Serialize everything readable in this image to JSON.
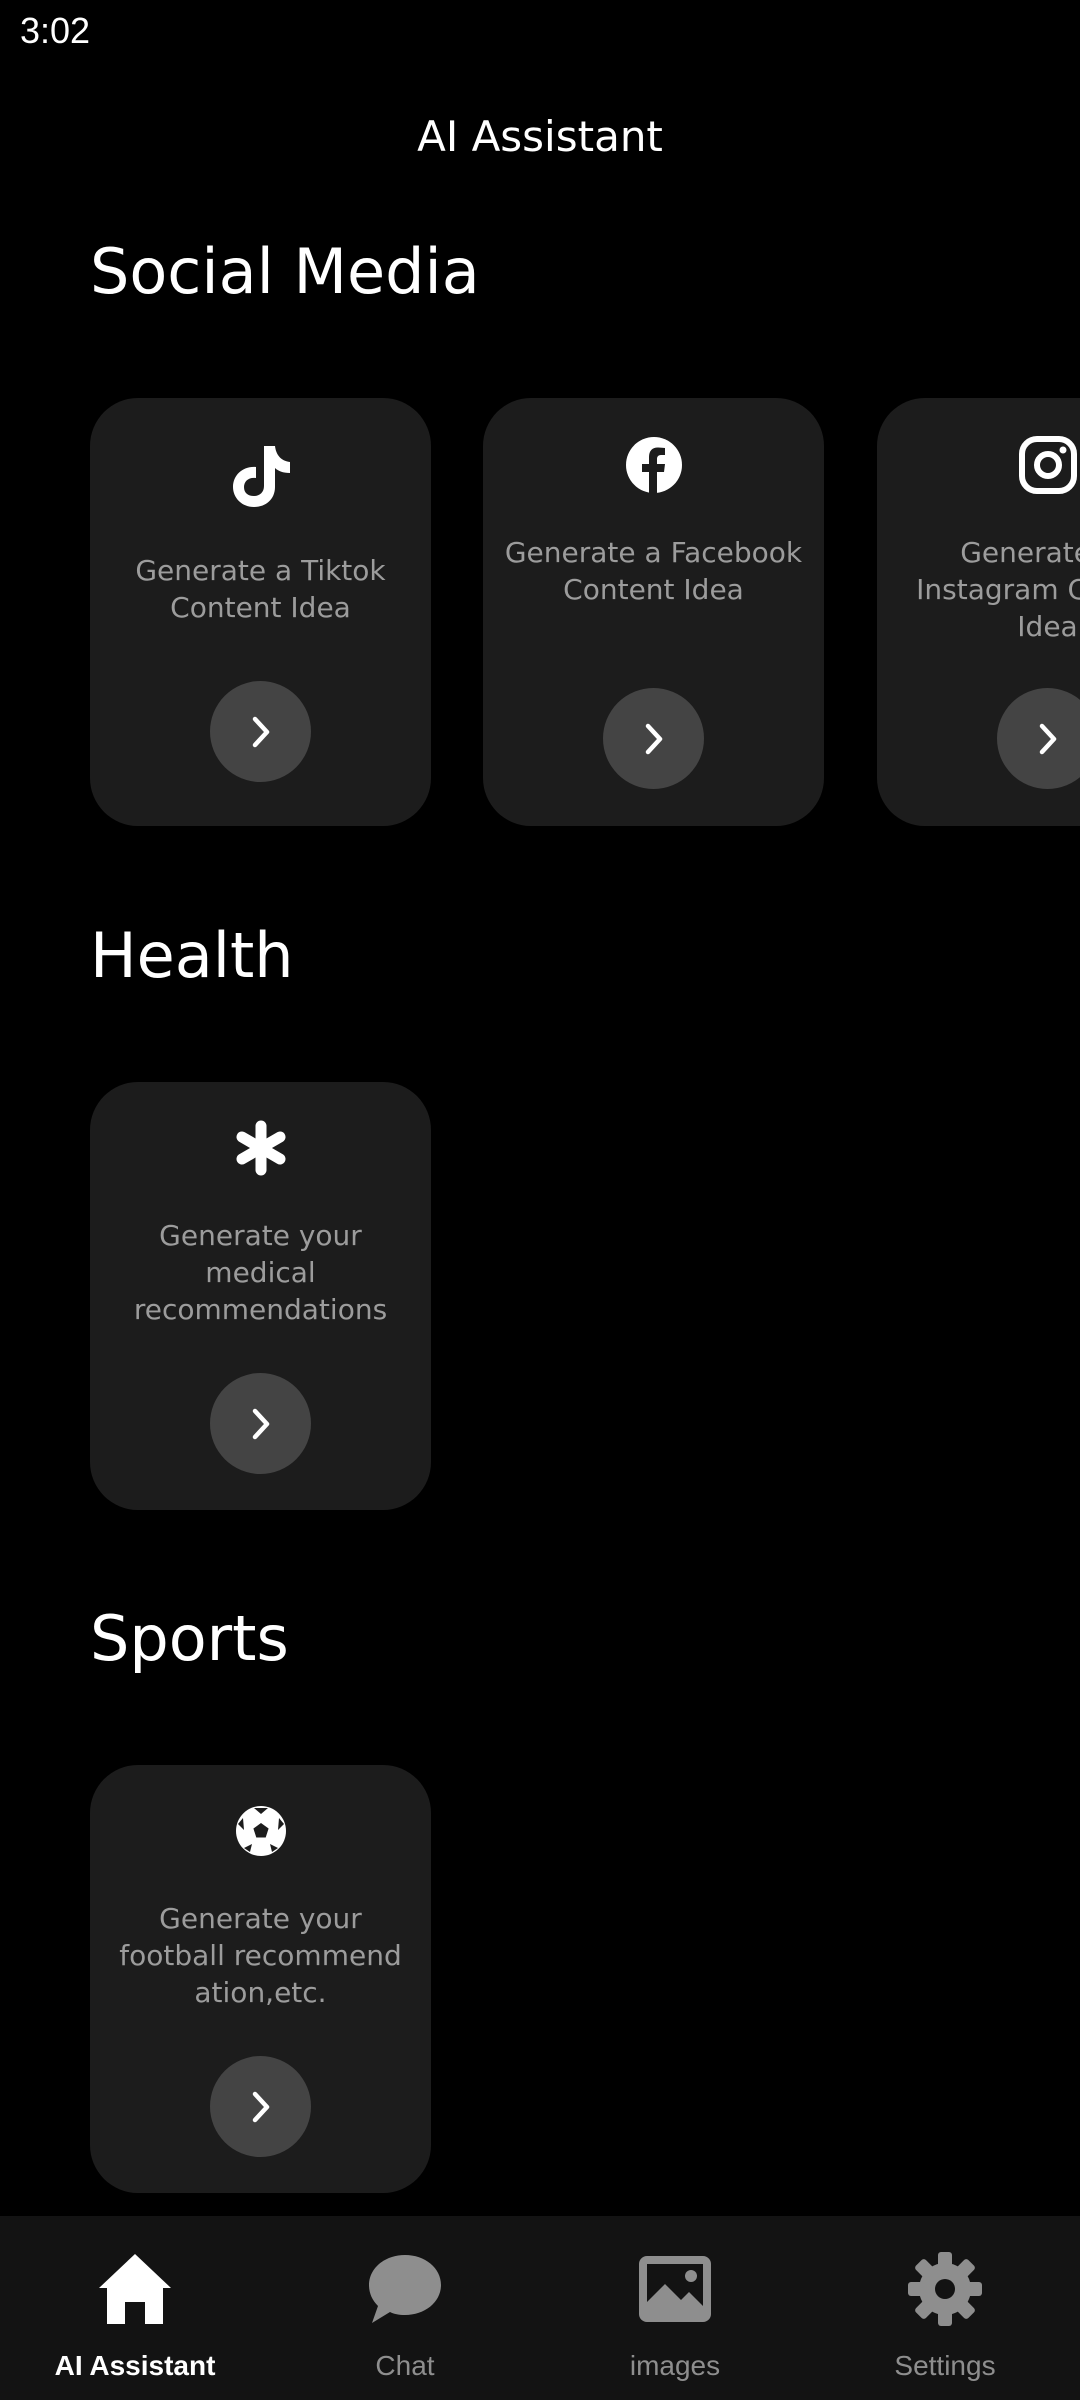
{
  "status_bar": {
    "time": "3:02"
  },
  "header": {
    "title": "AI Assistant"
  },
  "sections": [
    {
      "title": "Social Media",
      "cards": [
        {
          "icon": "tiktok-icon",
          "text": "Generate a Tiktok Content Idea"
        },
        {
          "icon": "facebook-icon",
          "text": "Generate a Facebook Content Idea"
        },
        {
          "icon": "instagram-icon",
          "text": "Generate an Instagram Content Idea"
        }
      ]
    },
    {
      "title": "Health",
      "cards": [
        {
          "icon": "asterisk-icon",
          "text": "Generate your medical recommendations"
        }
      ]
    },
    {
      "title": "Sports",
      "cards": [
        {
          "icon": "soccer-ball-icon",
          "text": "Generate your football recommend ation,etc."
        }
      ]
    }
  ],
  "bottom_nav": {
    "items": [
      {
        "label": "AI Assistant",
        "icon": "home-icon",
        "active": true
      },
      {
        "label": "Chat",
        "icon": "chat-bubble-icon",
        "active": false
      },
      {
        "label": "images",
        "icon": "image-icon",
        "active": false
      },
      {
        "label": "Settings",
        "icon": "gear-icon",
        "active": false
      }
    ]
  },
  "colors": {
    "background": "#000000",
    "card": "#1c1c1c",
    "card_text": "#9c9c9c",
    "button": "#444444",
    "nav_background": "#131313",
    "nav_inactive": "#8e8e8e",
    "nav_active": "#ffffff"
  }
}
